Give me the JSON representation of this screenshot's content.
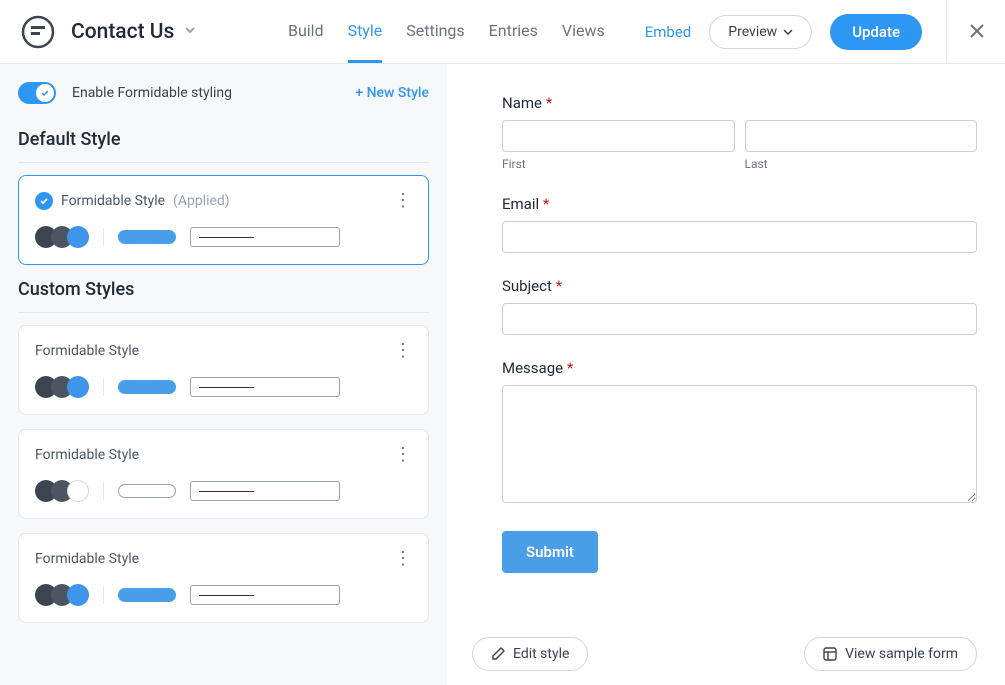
{
  "header": {
    "form_title": "Contact Us",
    "nav": {
      "build": "Build",
      "style": "Style",
      "settings": "Settings",
      "entries": "Entries",
      "views": "Views"
    },
    "embed": "Embed",
    "preview": "Preview",
    "update": "Update"
  },
  "sidebar": {
    "toggle_label": "Enable Formidable styling",
    "new_style": "New Style",
    "default_section": "Default Style",
    "custom_section": "Custom Styles",
    "default_card": {
      "name": "Formidable Style",
      "applied": "(Applied)",
      "colors": [
        "#3b4450",
        "#4d5560",
        "#3e95ea"
      ],
      "btn_color": "#4a9ee8"
    },
    "custom_cards": [
      {
        "name": "Formidable Style",
        "colors": [
          "#3b4450",
          "#4d5560",
          "#3e95ea"
        ],
        "btn_color": "#4a9ee8"
      },
      {
        "name": "Formidable Style",
        "colors": [
          "#3b4450",
          "#4d5560",
          "#ffffff"
        ],
        "btn_color": "#ffffff",
        "btn_border": "#9ca3af"
      },
      {
        "name": "Formidable Style",
        "colors": [
          "#3b4450",
          "#4d5560",
          "#3e95ea"
        ],
        "btn_color": "#4a9ee8"
      }
    ]
  },
  "form": {
    "name_label": "Name",
    "first_label": "First",
    "last_label": "Last",
    "email_label": "Email",
    "subject_label": "Subject",
    "message_label": "Message",
    "submit_label": "Submit"
  },
  "footer": {
    "edit_style": "Edit style",
    "view_sample": "View sample form"
  }
}
